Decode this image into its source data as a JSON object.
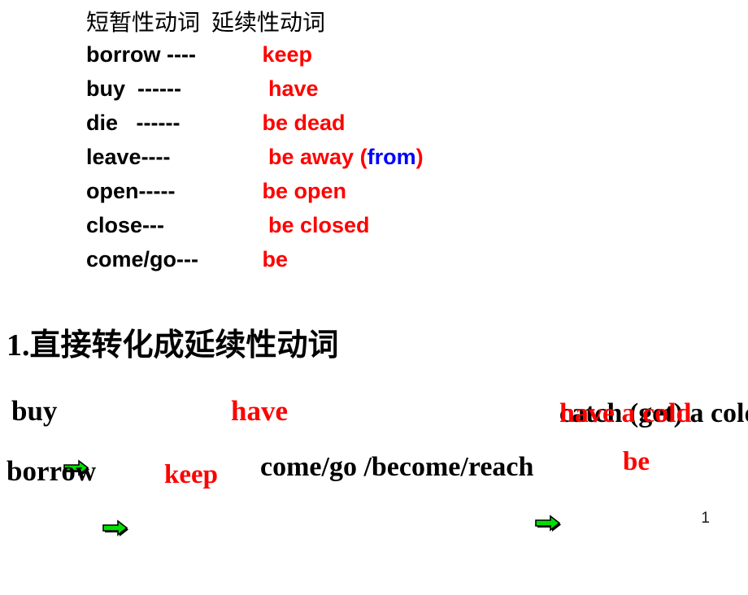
{
  "slide": {
    "page_number": "1",
    "background_color": "#ffffff"
  },
  "colors": {
    "black": "#000000",
    "red": "#ff0000",
    "blue": "#0000ff",
    "arrow_green": "#00e000",
    "arrow_outline": "#000000"
  },
  "verb_table": {
    "header": "短暂性动词  延续性动词",
    "header_col1": "短暂性动词",
    "header_col2": "延续性动词",
    "rows": [
      {
        "left": "borrow ----",
        "right": " keep"
      },
      {
        "left": "buy  ------",
        "right": "  have"
      },
      {
        "left": "die   ------",
        "right": " be dead"
      },
      {
        "left": "leave----",
        "right": "  be away ",
        "paren_open": "(",
        "paren_inner": "from",
        "paren_close": ")"
      },
      {
        "left": "open-----",
        "right": " be open"
      },
      {
        "left": "close---",
        "right": "  be closed"
      },
      {
        "left": "come/go---",
        "right": " be"
      }
    ]
  },
  "section": {
    "heading": "1.直接转化成延续性动词"
  },
  "conversions": [
    {
      "source": "buy",
      "target": "have"
    },
    {
      "source": "catch (get) a cold",
      "target": "have a cold"
    },
    {
      "source": "borrow",
      "target": "keep"
    },
    {
      "source": "come/go /become/reach",
      "target": "be"
    }
  ],
  "conversion_labels": {
    "buy": "buy",
    "have": "have",
    "catch_get_a_cold": "catch (get) a cold",
    "have_a_cold": "have a cold",
    "borrow": "borrow",
    "keep": "keep",
    "come_go_become_reach": "come/go /become/reach",
    "be": "be"
  },
  "icons": {
    "arrow": "right-block-arrow-icon"
  }
}
